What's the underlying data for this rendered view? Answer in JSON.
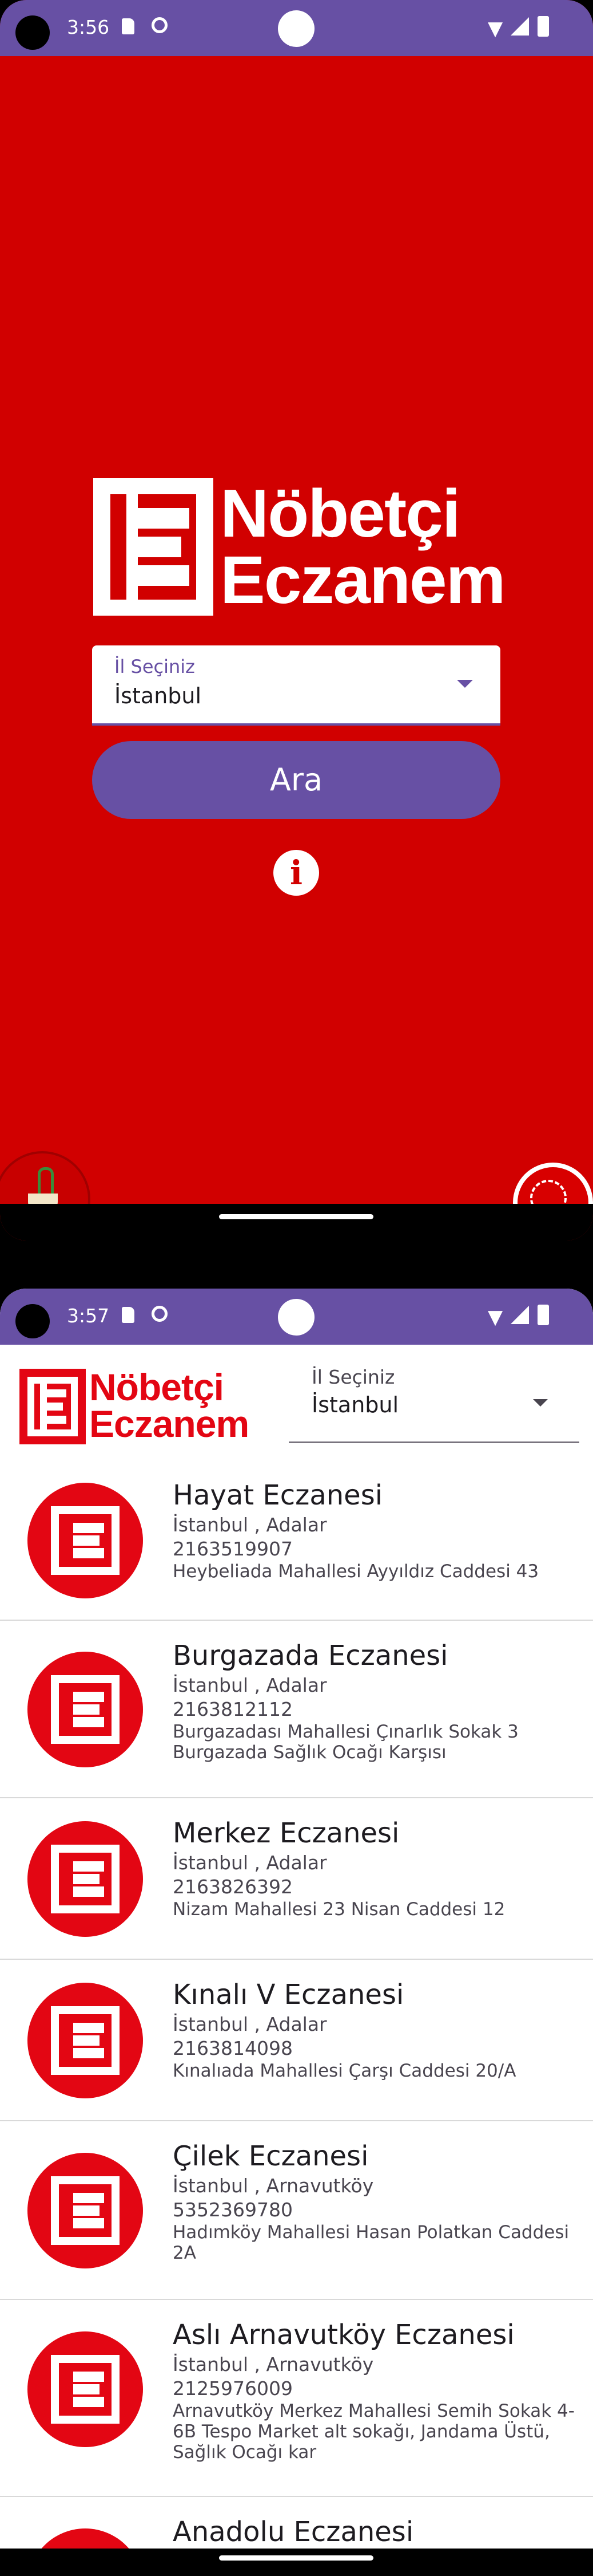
{
  "screen1": {
    "status_time": "3:56",
    "logo_line1": "Nöbetçi",
    "logo_line2": "Eczanem",
    "select_label": "İl Seçiniz",
    "select_value": "İstanbul",
    "search_button": "Ara",
    "info_glyph": "i",
    "icons": [
      "sd-card-icon",
      "sync-icon",
      "wifi-icon",
      "signal-icon",
      "battery-icon",
      "info-icon",
      "pharmacy-emblem",
      "ministry-emblem"
    ]
  },
  "screen2": {
    "status_time": "3:57",
    "logo_line1": "Nöbetçi",
    "logo_line2": "Eczanem",
    "select_label": "İl Seçiniz",
    "select_value": "İstanbul",
    "pharmacies": [
      {
        "name": "Hayat Eczanesi",
        "location": "İstanbul , Adalar",
        "phone": "2163519907",
        "address": "Heybeliada Mahallesi Ayyıldız Caddesi 43"
      },
      {
        "name": "Burgazada Eczanesi",
        "location": "İstanbul , Adalar",
        "phone": "2163812112",
        "address": "Burgazadası Mahallesi Çınarlık Sokak 3 Burgazada Sağlık Ocağı Karşısı"
      },
      {
        "name": "Merkez Eczanesi",
        "location": "İstanbul , Adalar",
        "phone": "2163826392",
        "address": "Nizam Mahallesi 23 Nisan Caddesi 12"
      },
      {
        "name": "Kınalı V Eczanesi",
        "location": "İstanbul , Adalar",
        "phone": "2163814098",
        "address": "Kınalıada Mahallesi Çarşı Caddesi 20/A"
      },
      {
        "name": "Çilek Eczanesi",
        "location": "İstanbul , Arnavutköy",
        "phone": "5352369780",
        "address": "Hadımköy Mahallesi Hasan Polatkan Caddesi 2A"
      },
      {
        "name": "Aslı Arnavutköy Eczanesi",
        "location": "İstanbul , Arnavutköy",
        "phone": "2125976009",
        "address": "Arnavutköy Merkez Mahallesi Semih Sokak 4-6B Tespo Market alt sokağı, Jandama Üstü, Sağlık Ocağı kar"
      },
      {
        "name": "Anadolu Eczanesi",
        "location": "",
        "phone": "",
        "address": ""
      }
    ]
  },
  "colors": {
    "primary": "#6750a4",
    "brand_red": "#d10000",
    "logo_red": "#e30613"
  }
}
